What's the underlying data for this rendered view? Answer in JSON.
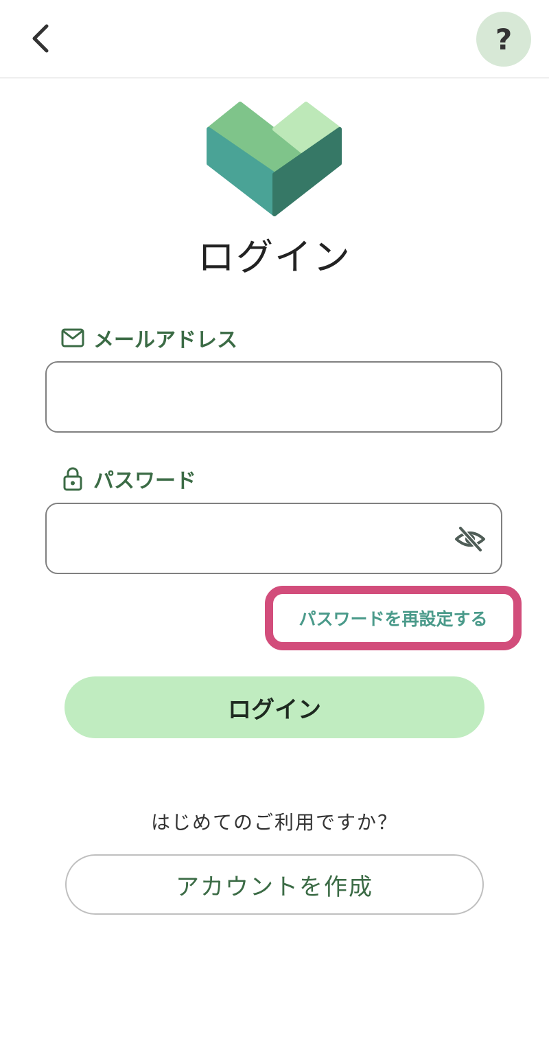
{
  "header": {
    "back_icon": "chevron-left-icon",
    "help_label": "?"
  },
  "logo": {
    "icon": "heart-cube-logo",
    "colors": [
      "#7fc48a",
      "#bde8b8",
      "#4aa396",
      "#367866"
    ]
  },
  "title": "ログイン",
  "email": {
    "icon": "mail-icon",
    "label": "メールアドレス",
    "value": ""
  },
  "password": {
    "icon": "lock-icon",
    "label": "パスワード",
    "value": "",
    "toggle_icon": "eye-off-icon"
  },
  "reset_link": "パスワードを再設定する",
  "login_button": "ログイン",
  "signup": {
    "prompt": "はじめてのご利用ですか？",
    "button": "アカウントを作成"
  },
  "colors": {
    "accent_green": "#3b6b45",
    "login_button_bg": "#c0ecc0",
    "help_bg": "#d7e8d6",
    "highlight": "#d24d7b",
    "link": "#4a9a8a"
  }
}
